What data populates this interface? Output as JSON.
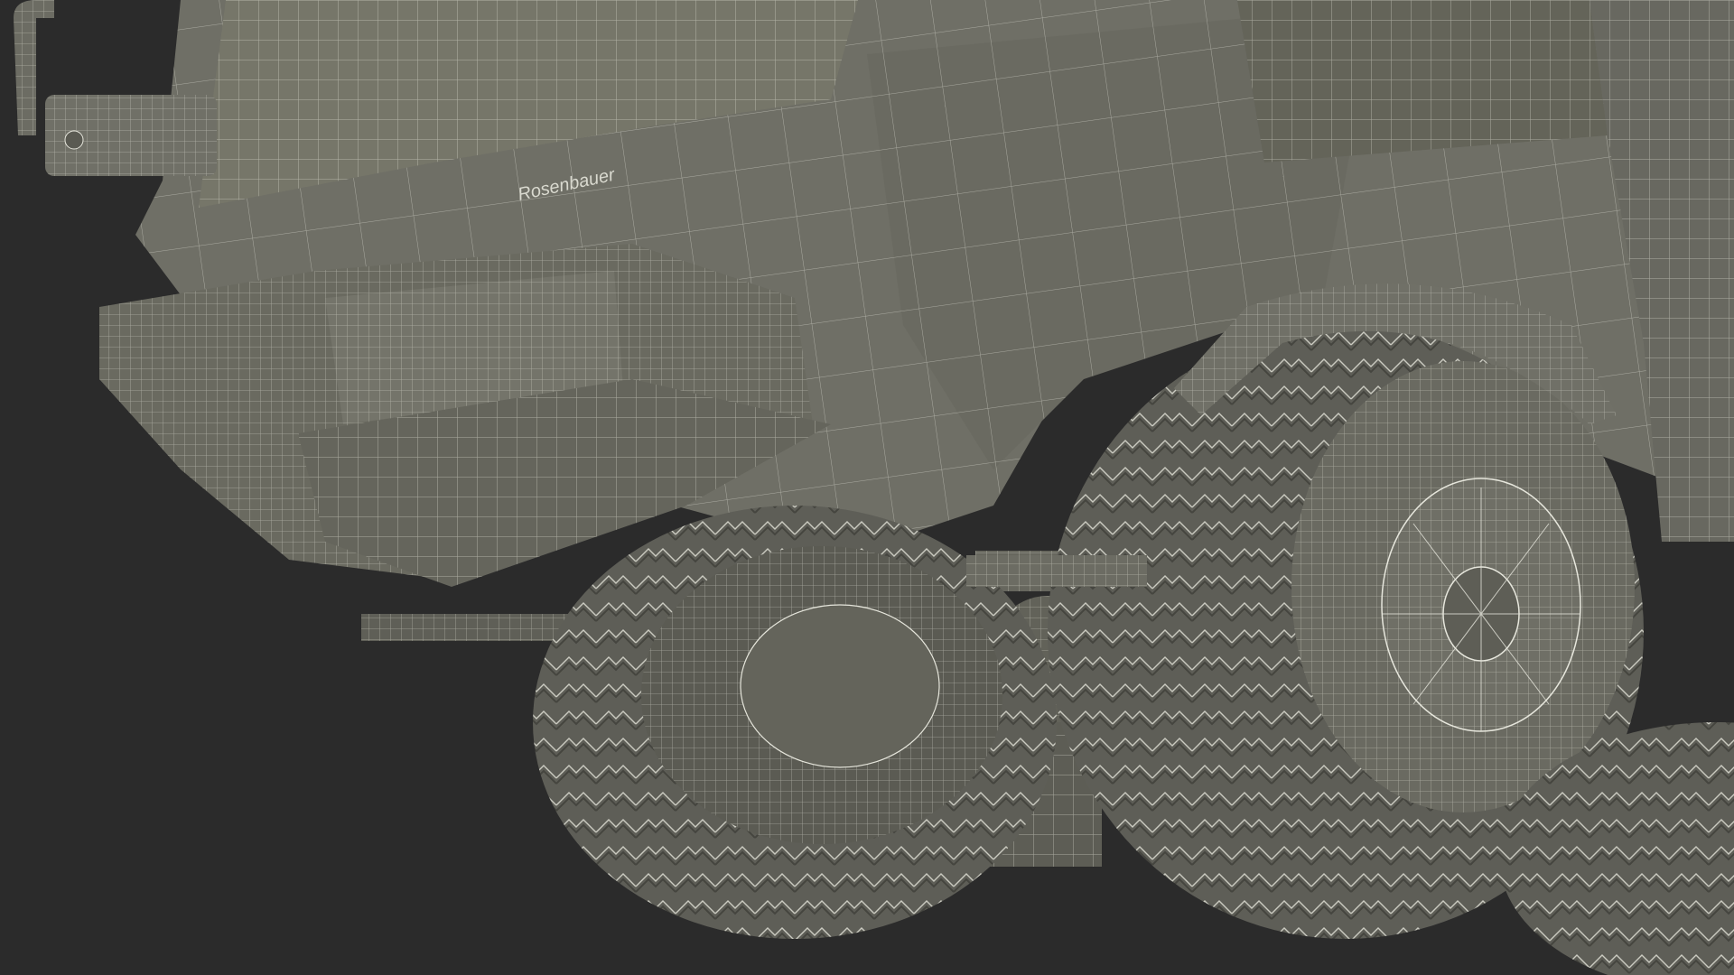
{
  "scene": {
    "subject": "wireframe-armored-vehicle-render",
    "logo_text": "Rosenbauer"
  },
  "colors": {
    "background": "#2b2b2b",
    "body_fill": "#6f6f66",
    "body_shade": "#5c5c54",
    "tire_fill": "#5e5e57",
    "wire": "#e6e6dc"
  }
}
